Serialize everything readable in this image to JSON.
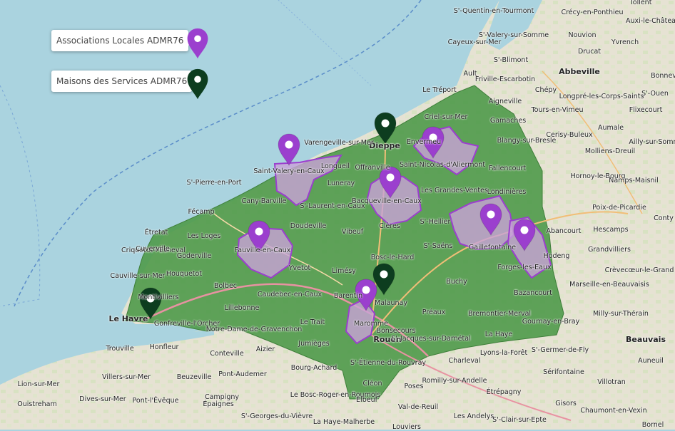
{
  "legend": {
    "associations_label": "Associations Locales ADMR76",
    "maisons_label": "Maisons des Services ADMR76",
    "colors": {
      "associations": "#9b3fce",
      "maisons": "#0d3d1f"
    }
  },
  "map": {
    "colors": {
      "sea": "#aad3df",
      "land": "#e9e4d6",
      "department": "#4f9a4a",
      "local_area": "#c9a3d8",
      "local_area_outline": "#9b3fce",
      "road": "#f1be77",
      "motorway": "#e892a2"
    },
    "markers": {
      "associations": [
        {
          "name": "Saint-Valery-en-Caux"
        },
        {
          "name": "Bacqueville-en-Caux"
        },
        {
          "name": "Saint-Nicolas-d'Aliermont"
        },
        {
          "name": "Fauville-en-Caux"
        },
        {
          "name": "Gaillefontaine"
        },
        {
          "name": "Forges-les-Eaux"
        },
        {
          "name": "Maromme"
        }
      ],
      "maisons": [
        {
          "name": "Dieppe"
        },
        {
          "name": "Le Havre"
        },
        {
          "name": "Malaunay"
        }
      ]
    },
    "places": [
      "Crécy-en-Ponthieu",
      "Tollent",
      "Auxi-le-Château",
      "S'-Quentin-en-Tourmont",
      "S'-Valery-sur-Somme",
      "Nouvion",
      "Cayeux-sur-Mer",
      "Drucat",
      "S'-Blimont",
      "Yvrench",
      "Abbeville",
      "Ault",
      "Friville-Escarbotin",
      "Bonnev",
      "Le Tréport",
      "Chépy",
      "Longpré-les-Corps-Saints",
      "S'-Ouen",
      "Aigneville",
      "Tours-en-Vimeu",
      "Flixecourt",
      "Criel-sur-Mer",
      "Gamaches",
      "Blangy-sur-Bresle",
      "Cerisy-Buleux",
      "Ailly-sur-Somme",
      "Envermeu",
      "Aumale",
      "Molliens-Dreuil",
      "Dieppe",
      "Varengeville-sur-Mer",
      "Longueil",
      "Offranville",
      "Fallencourt",
      "Hornoy-le-Bourg",
      "Namps-Maisnil",
      "Saint-Valery-en-Caux",
      "Bacqueville-en-Caux",
      "Saint-Nicolas-d'Aliermont",
      "Londinières",
      "Les Grandes-Ventes",
      "Poix-de-Picardie",
      "Conty",
      "Luneray",
      "S'-Laurent-en-Caux",
      "Clères",
      "Fécamp",
      "S'-Pierre-en-Port",
      "Cany-Barville",
      "Abancourt",
      "Hescamps",
      "Grandvilliers",
      "Étretat",
      "Les Loges",
      "Doudeville",
      "Vibeuf",
      "S'-Hellier",
      "Auffay",
      "Gaillefontaine",
      "Fauville-en-Caux",
      "S'-Saëns",
      "Criquetot-l'Esneval",
      "Goderville",
      "Yvetot",
      "Bosc-le-Hard",
      "Forges-les-Eaux",
      "Hodeng",
      "Crèvecœur-le-Grand",
      "Cuverville",
      "Houquetot",
      "Limésy",
      "Buchy",
      "Marseille-en-Beauvaisis",
      "Cauville-sur-Mer",
      "Bolbec",
      "Caudebec-en-Caux",
      "Barentin",
      "Malaunay",
      "Montivilliers",
      "Bazancourt",
      "Lillebonne",
      "Préaux",
      "Bonsecours",
      "Gournay-en-Bray",
      "Milly-sur-Thérain",
      "Le Havre",
      "Gonfreville-l'Orcher",
      "Le Trait",
      "Maromme",
      "Bremontier-Merval",
      "Notre-Dame-de-Gravenchon",
      "Rouen",
      "La Haye",
      "Beauvais",
      "Honfleur",
      "Trouville",
      "Jumièges",
      "S'-Jacques-sur-Darnétal",
      "Lyons-la-Forêt",
      "S'-Germer-de-Fly",
      "Conteville",
      "Aizier",
      "S'-Étienne-du-Rouvray",
      "Charleval",
      "Sérifontaine",
      "Auneuil",
      "Bourg-Achard",
      "Romilly-sur-Andelle",
      "Villers-sur-Mer",
      "Beuzeville",
      "Pont-Audemer",
      "Le Bosc-Roger-en-Roumois",
      "Cléon",
      "Poses",
      "Étrépagny",
      "Lion-sur-Mer",
      "Dives-sur-Mer",
      "Pont-l'Évêque",
      "Campigny",
      "Elbeuf",
      "Val-de-Reuil",
      "Gisors",
      "Chaumont-en-Vexin",
      "Ouistreham",
      "Épaignes",
      "S'-Georges-du-Vièvre",
      "La Haye-Malherbe",
      "Louviers",
      "Les Andelys",
      "S'-Clair-sur-Epte",
      "Villotran",
      "Bornel"
    ]
  }
}
